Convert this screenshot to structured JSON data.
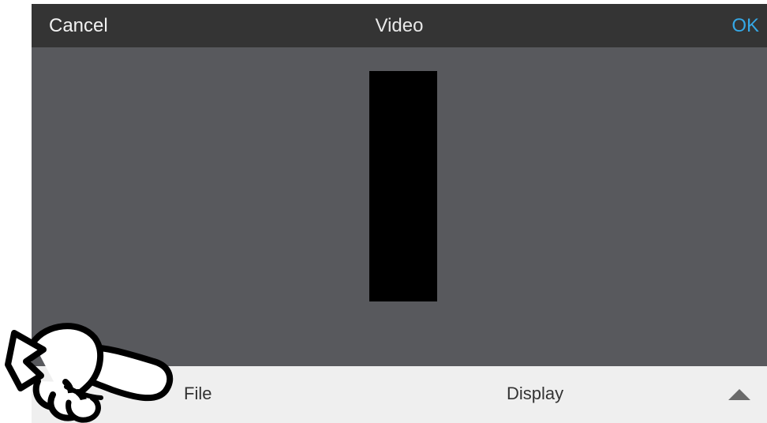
{
  "header": {
    "cancel_label": "Cancel",
    "title": "Video",
    "ok_label": "OK"
  },
  "footer": {
    "file_tab": "File",
    "display_tab": "Display",
    "expand_icon": "triangle-up-icon"
  },
  "colors": {
    "accent": "#35a8e6",
    "topbar": "#343434",
    "canvas": "#58595d",
    "footer": "#efefef"
  }
}
